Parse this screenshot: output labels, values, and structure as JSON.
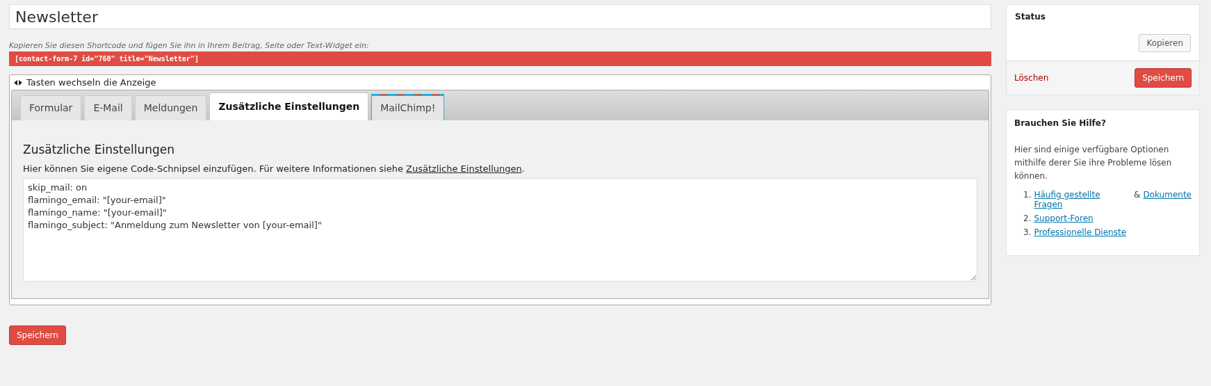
{
  "title_field": {
    "value": "Newsletter"
  },
  "shortcode": {
    "hint": "Kopieren Sie diesen Shortcode und fügen Sie ihn in Ihrem Beitrag, Seite oder Text-Widget ein:",
    "code": "[contact-form-7 id=\"760\" title=\"Newsletter\"]"
  },
  "tab_panel": {
    "hint": "Tasten wechseln die Anzeige",
    "tabs": [
      {
        "label": "Formular",
        "selected": false
      },
      {
        "label": "E-Mail",
        "selected": false
      },
      {
        "label": "Meldungen",
        "selected": false
      },
      {
        "label": "Zusätzliche Einstellungen",
        "selected": true
      },
      {
        "label": "MailChimp!",
        "selected": false,
        "kind": "striped"
      }
    ],
    "heading": "Zusätzliche Einstellungen",
    "description": "Hier können Sie eigene Code-Schnipsel einzufügen. Für weitere Informationen siehe ",
    "description_link": "Zusätzliche Einstellungen",
    "description_end": ".",
    "settings_value": "skip_mail: on\nflamingo_email: \"[your-email]\"\nflamingo_name: \"[your-email]\"\nflamingo_subject: \"Anmeldung zum Newsletter von [your-email]\""
  },
  "save_button": "Speichern",
  "status_box": {
    "title": "Status",
    "copy_button": "Kopieren",
    "delete_link": "Löschen",
    "save_button": "Speichern"
  },
  "help_box": {
    "title": "Brauchen Sie Hilfe?",
    "text": "Hier sind einige verfügbare Optionen mithilfe derer Sie ihre Probleme lösen können.",
    "items": [
      {
        "number": "1.",
        "links": [
          "Häufig gestellte Fragen",
          "Dokumente"
        ],
        "separator": "&"
      },
      {
        "number": "2.",
        "links": [
          "Support-Foren"
        ]
      },
      {
        "number": "3.",
        "links": [
          "Professionelle Dienste"
        ]
      }
    ]
  }
}
